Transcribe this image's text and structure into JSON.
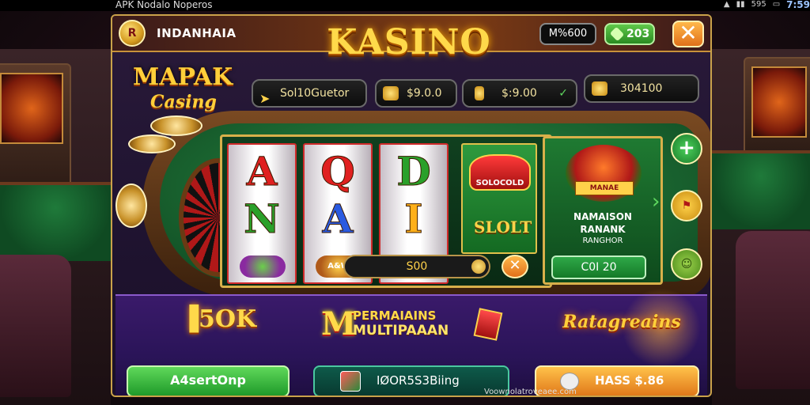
{
  "status_bar": {
    "app_label": "APK Nodalo Noperos",
    "time": "7:59",
    "battery": "595"
  },
  "header": {
    "logo_letter": "R",
    "brand": "INDANHAIA",
    "title": "KASINO",
    "balance": "M%600",
    "coins": "203",
    "close_symbol": "✕"
  },
  "game_logo": {
    "line1": "MAPAK",
    "line2": "Casing"
  },
  "info_pills": [
    {
      "icon": "arrow-icon",
      "text": "Sol10Guetor"
    },
    {
      "icon": "gold-gem-icon",
      "text": "$9.0.0"
    },
    {
      "icon": "gold-bar-icon",
      "text": "$:9.00"
    },
    {
      "icon": "gold-hex-icon",
      "text": "304100"
    }
  ],
  "reels": {
    "row1": [
      "A",
      "Q",
      "D"
    ],
    "row2": [
      "N",
      "A",
      "I"
    ],
    "mini_label": "A&W"
  },
  "slot": {
    "badge": "SOLOCOLD",
    "word": "SLOLT",
    "bet_value": "S00"
  },
  "bonus": {
    "banner": "MANAE",
    "line1": "NAMAISON",
    "line2": "RANANK",
    "line3": "RANGHOR",
    "button": "C0I 20"
  },
  "promo": {
    "big_amount": "▐5OK",
    "center_letter": "M",
    "center_line1": "PERMAIAINS",
    "center_line2": "MULTIPAAAN",
    "right_title": "Ratagreains",
    "btn_green": "A4sertOnp",
    "btn_dark": "IØOR5S3Biing",
    "btn_orange": "HASS $.86"
  },
  "footer": {
    "url": "Voownolatroveaee.com"
  },
  "colors": {
    "gold": "#ffd94a",
    "green": "#2ea848",
    "orange": "#e0781a",
    "felt": "#1f7a3a"
  }
}
